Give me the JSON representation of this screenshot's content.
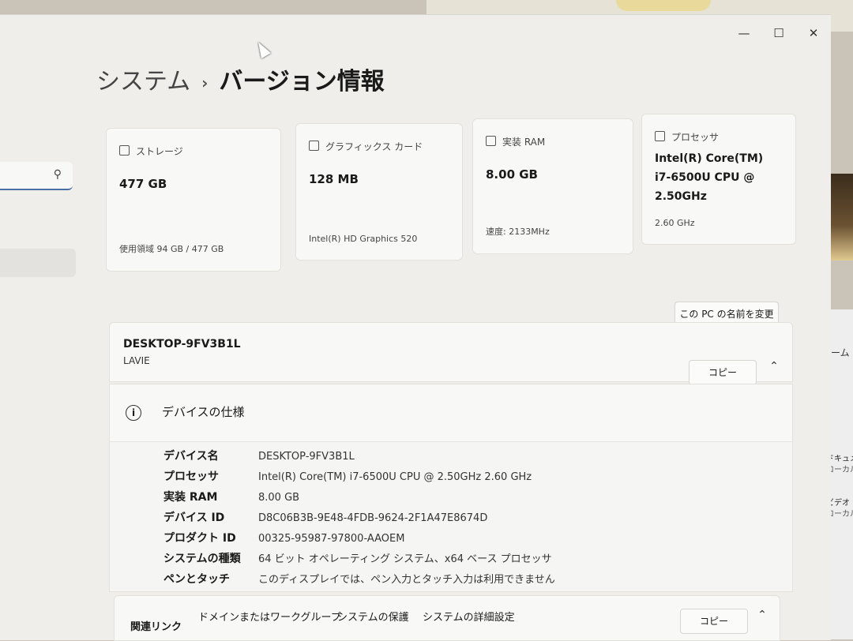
{
  "window": {
    "minimize": "—",
    "maximize": "☐",
    "close": "✕"
  },
  "breadcrumb": {
    "parent": "システム",
    "separator": "›",
    "current": "バージョン情報"
  },
  "cards": [
    {
      "title": "ストレージ",
      "value": "477 GB",
      "footer": "使用領域 94 GB / 477 GB"
    },
    {
      "title": "グラフィックス カード",
      "value": "128 MB",
      "footer": "Intel(R) HD Graphics 520"
    },
    {
      "title": "実装 RAM",
      "value": "8.00 GB",
      "footer": "速度: 2133MHz"
    },
    {
      "title": "プロセッサ",
      "value": "Intel(R) Core(TM) i7-6500U CPU @ 2.50GHz",
      "footer": "2.60 GHz"
    }
  ],
  "rename_button": "この PC の名前を変更",
  "pc": {
    "name": "DESKTOP-9FV3B1L",
    "model": "LAVIE"
  },
  "specs": {
    "title": "デバイスの仕様",
    "copy_label": "コピー",
    "rows": [
      {
        "label": "デバイス名",
        "value": "DESKTOP-9FV3B1L"
      },
      {
        "label": "プロセッサ",
        "value": "Intel(R) Core(TM) i7-6500U CPU @ 2.50GHz   2.60 GHz"
      },
      {
        "label": "実装 RAM",
        "value": "8.00 GB"
      },
      {
        "label": "デバイス ID",
        "value": "D8C06B3B-9E48-4FDB-9624-2F1A47E8674D"
      },
      {
        "label": "プロダクト ID",
        "value": "00325-95987-97800-AAOEM"
      },
      {
        "label": "システムの種類",
        "value": "64 ビット オペレーティング システム、x64 ベース プロセッサ"
      },
      {
        "label": "ペンとタッチ",
        "value": "このディスプレイでは、ペン入力とタッチ入力は利用できません"
      }
    ]
  },
  "related": {
    "title": "関連リンク",
    "links": [
      "ドメインまたはワークグループ",
      "システムの保護",
      "システムの詳細設定"
    ],
    "copy_label": "コピー"
  },
  "background_window": {
    "tab": "ホームの",
    "items": [
      {
        "line1": "ドキュメ",
        "line2": "ローカル",
        "color": "#3c5a78"
      },
      {
        "line1": "ビデオ",
        "line2": "ローカル",
        "color": "#7a3cc8"
      }
    ]
  }
}
